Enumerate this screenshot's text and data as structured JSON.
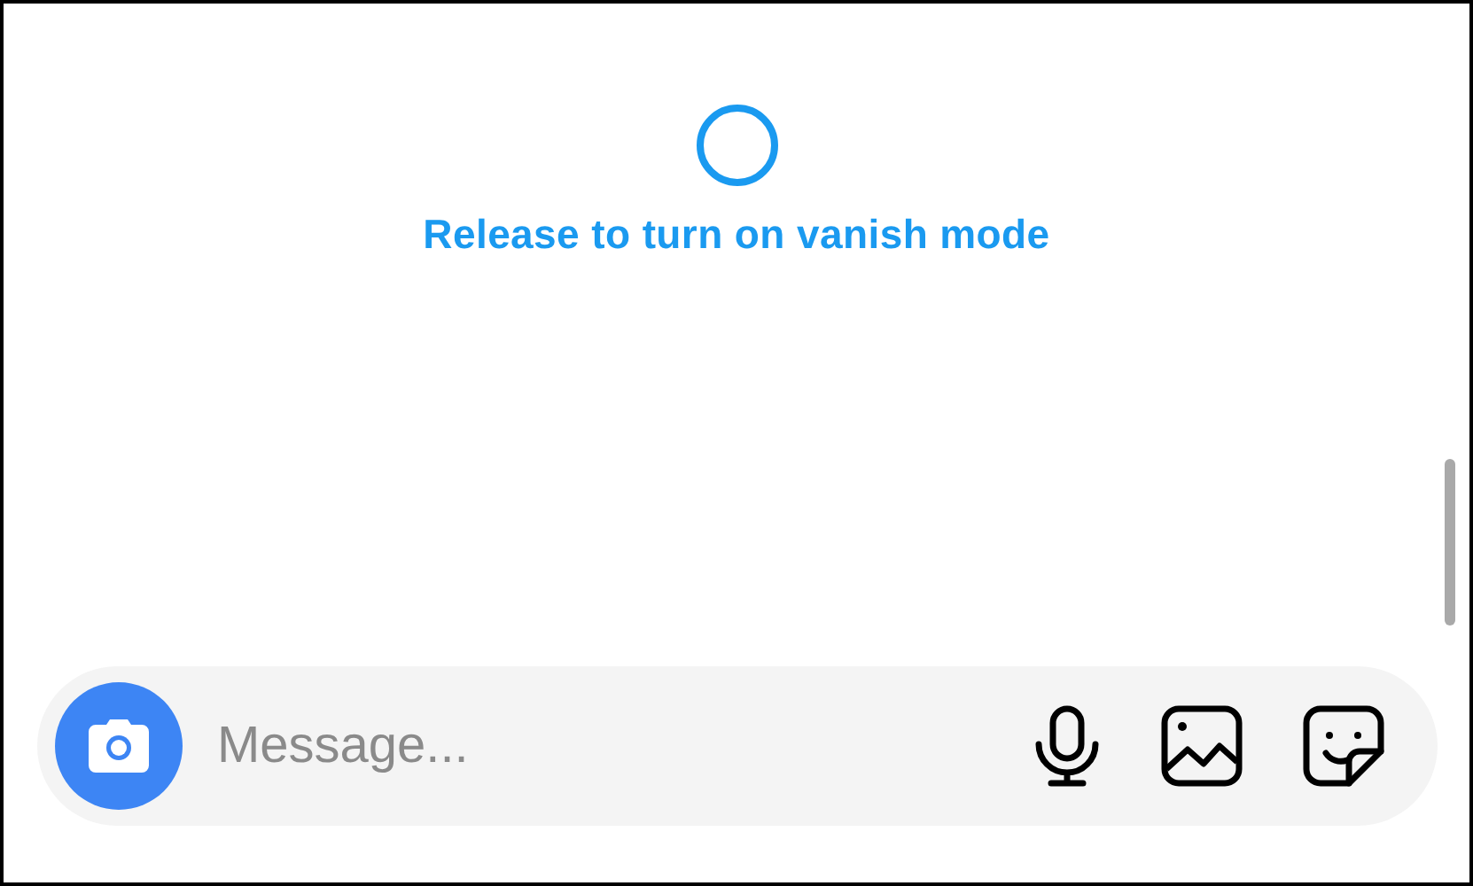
{
  "vanish_prompt": {
    "text": "Release to turn on vanish mode"
  },
  "composer": {
    "placeholder": "Message..."
  }
}
